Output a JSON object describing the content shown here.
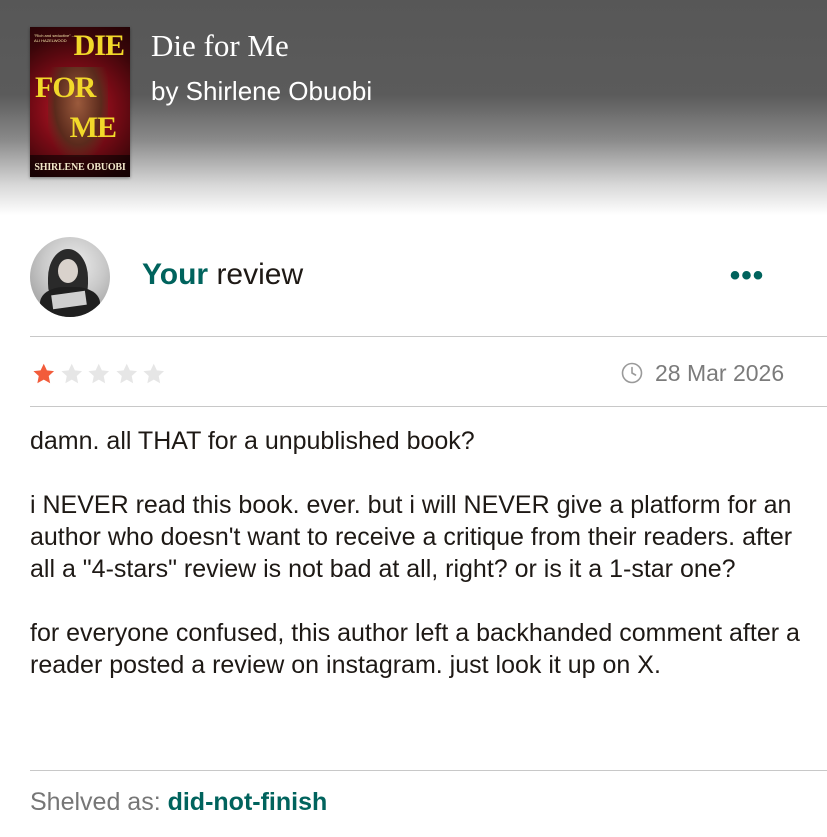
{
  "book": {
    "title": "Die for Me",
    "author_line": "by Shirlene Obuobi",
    "cover": {
      "title_words": [
        "DIE",
        "FOR",
        "ME"
      ],
      "author": "SHIRLENE OBUOBI",
      "tagline": "\"Rich and seductive\" —ALI HAZELWOOD"
    }
  },
  "review": {
    "heading_highlight": "Your",
    "heading_rest": " review",
    "rating": 1,
    "max_rating": 5,
    "star_filled_color": "#f25c3b",
    "star_empty_color": "#e6e6e6",
    "date": "28 Mar 2026",
    "paragraphs": [
      "damn. all THAT for a unpublished book?",
      "i NEVER read this book. ever. but i will NEVER give a platform for an author who doesn't want to receive a critique from their readers. after all a \"4-stars\" review is not bad at all, right? or is it a 1-star one?",
      "for everyone confused, this author left a backhanded comment after a reader posted a review on instagram. just look it up on X."
    ],
    "shelved_label": "Shelved as:",
    "shelf": "did-not-finish"
  },
  "menu": {
    "more_label": "•••",
    "icon": "more-options-icon"
  },
  "colors": {
    "accent": "#00635d",
    "header_gray": "#5b5b5b"
  }
}
